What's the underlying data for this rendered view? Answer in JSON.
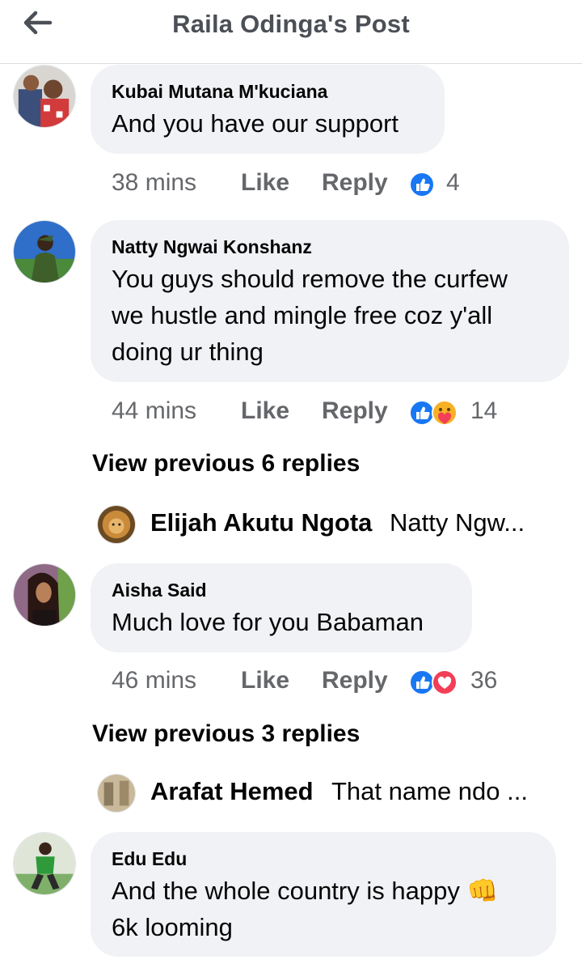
{
  "header": {
    "title": "Raila Odinga's Post",
    "back_icon": "back-arrow-icon"
  },
  "comments": [
    {
      "author": "Kubai Mutana M'kuciana",
      "text": "And you have our support",
      "time": "38 mins",
      "like": "Like",
      "reply": "Reply",
      "reactions": [
        "like"
      ],
      "count": "4"
    },
    {
      "author": "Natty Ngwai Konshanz",
      "text_lines": [
        "You guys should remove the curfew",
        "we hustle and mingle free coz y'all",
        "doing ur thing"
      ],
      "time": "44 mins",
      "like": "Like",
      "reply": "Reply",
      "reactions": [
        "like",
        "care"
      ],
      "count": "14"
    },
    {
      "author": "Aisha Said",
      "text": "Much love for you Babaman",
      "time": "46 mins",
      "like": "Like",
      "reply": "Reply",
      "reactions": [
        "like",
        "love"
      ],
      "count": "36"
    },
    {
      "author": "Edu Edu",
      "text_lines": [
        "And the whole country is happy",
        "6k looming"
      ],
      "emoji": "fist-bump",
      "emoji_char": "👊"
    }
  ],
  "view_previous": [
    "View previous 6 replies",
    "View previous 3 replies"
  ],
  "reply_previews": [
    {
      "name": "Elijah Akutu Ngota",
      "text": "Natty Ngw..."
    },
    {
      "name": "Arafat Hemed",
      "text": "That name ndo ..."
    }
  ],
  "colors": {
    "like_blue": "#1877f2",
    "love_red": "#f33e58",
    "bubble_bg": "#f0f2f5",
    "meta_gray": "#65676b"
  }
}
